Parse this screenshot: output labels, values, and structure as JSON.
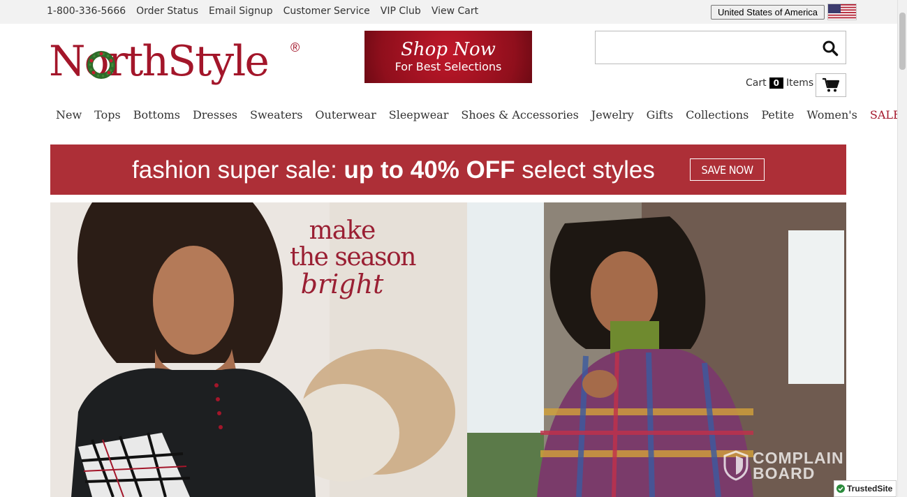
{
  "topbar": {
    "links": [
      "1-800-336-5666",
      "Order Status",
      "Email Signup",
      "Customer Service",
      "VIP Club",
      "View Cart"
    ],
    "country": "United States of America"
  },
  "logo": {
    "text": "NorthStyle",
    "reg": "®"
  },
  "shop_banner": {
    "line1": "Shop Now",
    "line2": "For Best Selections"
  },
  "search": {
    "placeholder": "",
    "value": ""
  },
  "cart": {
    "label": "Cart",
    "count": "0",
    "items_label": "Items"
  },
  "nav": [
    "New",
    "Tops",
    "Bottoms",
    "Dresses",
    "Sweaters",
    "Outerwear",
    "Sleepwear",
    "Shoes & Accessories",
    "Jewelry",
    "Gifts",
    "Collections",
    "Petite",
    "Women's",
    "SALE"
  ],
  "promo": {
    "prefix": "fashion super sale: ",
    "bold": "up to 40% OFF",
    "suffix": " select styles",
    "button": "SAVE NOW"
  },
  "hero": {
    "line1": "make",
    "line2": "the season",
    "line3": "bright"
  },
  "watermark": {
    "line1": "COMPLAIN",
    "line2": "BOARD"
  },
  "trusted": "TrustedSite",
  "colors": {
    "brand": "#a3162a",
    "promo_bg": "#ad2f37"
  }
}
